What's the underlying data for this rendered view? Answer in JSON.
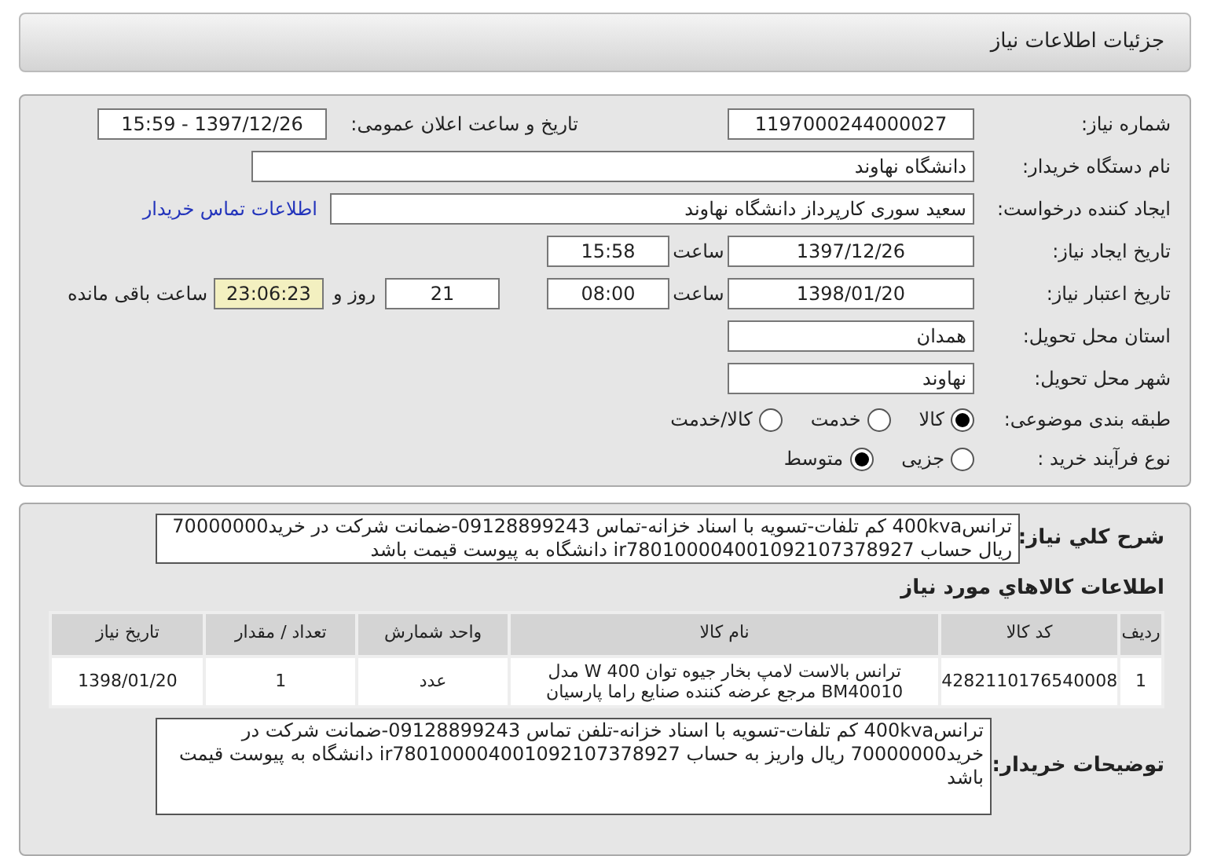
{
  "header": {
    "title": "جزئیات اطلاعات نیاز"
  },
  "form": {
    "need_number": {
      "label": "شماره نیاز:",
      "value": "1197000244000027"
    },
    "announce": {
      "label": "تاریخ و ساعت اعلان عمومی:",
      "value": "1397/12/26 - 15:59"
    },
    "buyer_org": {
      "label": "نام دستگاه خریدار:",
      "value": "دانشگاه نهاوند"
    },
    "requester": {
      "label": "ایجاد کننده درخواست:",
      "value": "سعید سوری کارپرداز دانشگاه نهاوند",
      "link": "اطلاعات تماس خریدار"
    },
    "created": {
      "label": "تاریخ ایجاد نیاز:",
      "date": "1397/12/26",
      "time_label": "ساعت",
      "time": "15:58"
    },
    "validity": {
      "label": "تاریخ اعتبار نیاز:",
      "date": "1398/01/20",
      "time_label": "ساعت",
      "time": "08:00",
      "days": "21",
      "days_label": "روز و",
      "remaining": "23:06:23",
      "remaining_label": "ساعت باقی مانده"
    },
    "province": {
      "label": "استان محل تحویل:",
      "value": "همدان"
    },
    "city": {
      "label": "شهر محل تحویل:",
      "value": "نهاوند"
    },
    "category": {
      "label": "طبقه بندی موضوعی:",
      "options": [
        {
          "label": "کالا",
          "selected": true
        },
        {
          "label": "خدمت",
          "selected": false
        },
        {
          "label": "کالا/خدمت",
          "selected": false
        }
      ]
    },
    "process": {
      "label": "نوع فرآیند خرید :",
      "options": [
        {
          "label": "جزیی",
          "selected": false
        },
        {
          "label": "متوسط",
          "selected": true
        }
      ]
    }
  },
  "description": {
    "label": "شرح کلي نياز:",
    "text": "ترانس400kva کم تلفات-تسویه با اسناد خزانه-تماس 09128899243-ضمانت شرکت در خرید70000000 ریال حساب ir780100004001092107378927 دانشگاه به پیوست قیمت باشد"
  },
  "goods_title": "اطلاعات کالاهاي مورد نياز",
  "table": {
    "columns": [
      "ردیف",
      "کد کالا",
      "نام کالا",
      "واحد شمارش",
      "تعداد / مقدار",
      "تاریخ نیاز"
    ],
    "rows": [
      [
        "1",
        "4282110176540008",
        "ترانس بالاست لامپ بخار جیوه توان W 400 مدل BM40010 مرجع عرضه کننده صنایع راما پارسیان",
        "عدد",
        "1",
        "1398/01/20"
      ]
    ]
  },
  "buyer_notes": {
    "label": "توضیحات خریدار:",
    "text": "ترانس400kva کم تلفات-تسویه با اسناد خزانه-تلفن تماس 09128899243-ضمانت شرکت در خرید70000000 ریال واریز به حساب ir780100004001092107378927 دانشگاه به پیوست قیمت باشد"
  }
}
